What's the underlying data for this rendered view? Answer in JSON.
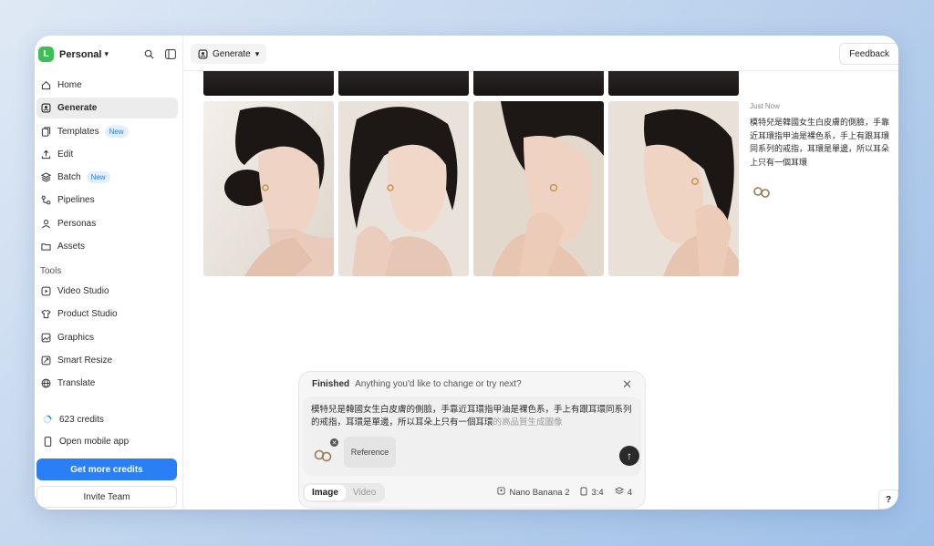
{
  "workspace": {
    "initial": "L",
    "name": "Personal"
  },
  "nav": [
    {
      "label": "Home",
      "icon": "home-icon"
    },
    {
      "label": "Generate",
      "icon": "generate-icon",
      "active": true
    },
    {
      "label": "Templates",
      "icon": "templates-icon",
      "badge": "New"
    },
    {
      "label": "Edit",
      "icon": "edit-icon"
    },
    {
      "label": "Batch",
      "icon": "batch-icon",
      "badge": "New"
    },
    {
      "label": "Pipelines",
      "icon": "pipelines-icon"
    },
    {
      "label": "Personas",
      "icon": "personas-icon"
    },
    {
      "label": "Assets",
      "icon": "assets-icon"
    }
  ],
  "tools_label": "Tools",
  "tools": [
    {
      "label": "Video Studio",
      "icon": "video-icon"
    },
    {
      "label": "Product Studio",
      "icon": "shirt-icon"
    },
    {
      "label": "Graphics",
      "icon": "graphics-icon"
    },
    {
      "label": "Smart Resize",
      "icon": "resize-icon"
    },
    {
      "label": "Translate",
      "icon": "globe-icon"
    }
  ],
  "credits": "623 credits",
  "mobile": "Open mobile app",
  "get_credits": "Get more credits",
  "invite": "Invite Team",
  "topbar": {
    "generate": "Generate",
    "feedback": "Feedback"
  },
  "result": {
    "time": "Just Now",
    "prompt": "模特兒是韓國女生白皮膚的側臉，手靠近耳環指甲油是裸色系，手上有跟耳環同系列的戒指，耳環是單邊，所以耳朵上只有一個耳環"
  },
  "composer": {
    "status": "Finished",
    "hint": "Anything you'd like to change or try next?",
    "text": "模特兒是韓國女生白皮膚的側臉，手靠近耳環指甲油是裸色系，手上有跟耳環同系列的戒指，耳環是單邊，所以耳朵上只有一個耳環",
    "ghost": "的高品質生成圖像",
    "reference": "Reference",
    "modes": [
      "Image",
      "Video"
    ],
    "model": "Nano Banana 2",
    "ratio": "3:4",
    "count": "4"
  },
  "help": "?",
  "colors": {
    "accent": "#2a7ff5",
    "workspace_badge": "#3cbf55",
    "new_badge_text": "#2f7ce8"
  }
}
